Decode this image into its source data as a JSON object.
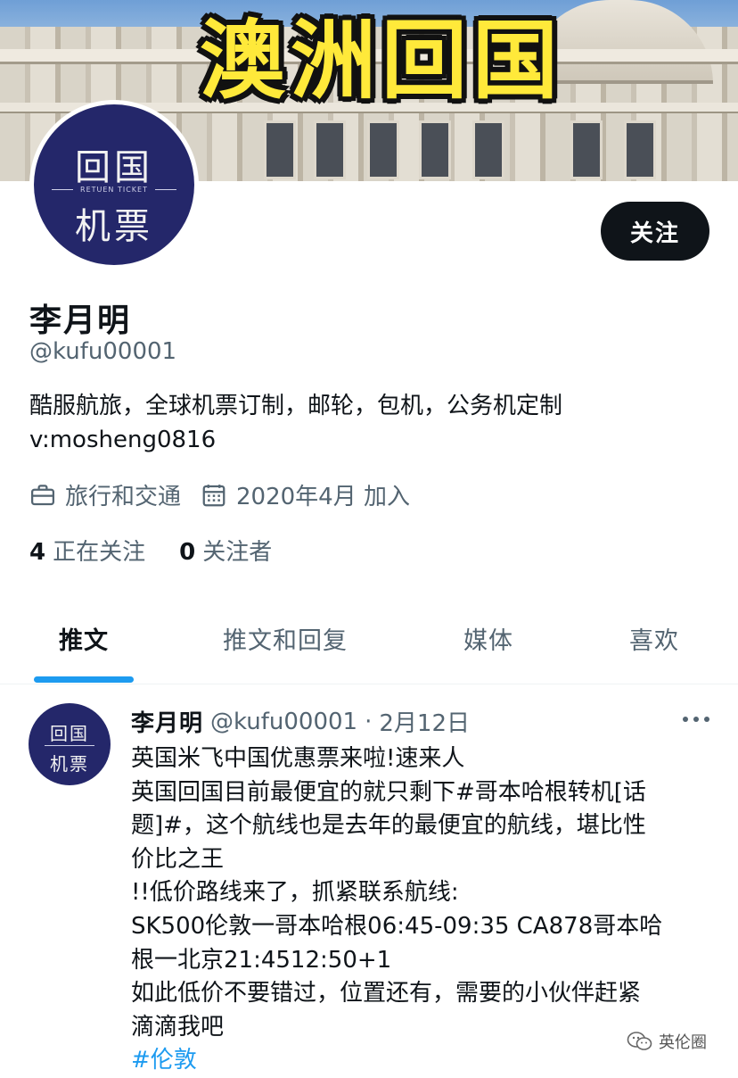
{
  "banner": {
    "title": "澳洲回国"
  },
  "avatar": {
    "line1": "回国",
    "line2": "机票",
    "tagline": "RETUEN TICKET"
  },
  "profile": {
    "follow_label": "关注",
    "name": "李月明",
    "handle": "@kufu00001",
    "bio_line1": "酷服航旅，全球机票订制，邮轮，包机，公务机定制",
    "bio_line2": "v:mosheng0816",
    "category": "旅行和交通",
    "joined": "2020年4月 加入",
    "following_count": "4",
    "following_label": "正在关注",
    "followers_count": "0",
    "followers_label": "关注者"
  },
  "tabs": [
    {
      "label": "推文",
      "active": true
    },
    {
      "label": "推文和回复",
      "active": false
    },
    {
      "label": "媒体",
      "active": false
    },
    {
      "label": "喜欢",
      "active": false
    }
  ],
  "tweet": {
    "author": "李月明",
    "handle": "@kufu00001",
    "separator": "·",
    "date": "2月12日",
    "lines": [
      "英国米飞中国优惠票来啦!速来人",
      "英国回国目前最便宜的就只剩下#哥本哈根转机[话",
      "题]#，这个航线也是去年的最便宜的航线，堪比性",
      "价比之王",
      "!!低价路线来了，抓紧联系航线:",
      "SK500伦敦一哥本哈根06:45-09:35 CA878哥本哈",
      "根一北京21:4512:50+1",
      "如此低价不要错过，位置还有，需要的小伙伴赶紧",
      "滴滴我吧"
    ],
    "hashtag": "#伦敦"
  },
  "watermark": {
    "text": "英伦圈"
  },
  "colors": {
    "accent": "#1d9bf0",
    "text": "#0f1419",
    "muted": "#536471",
    "avatar_bg": "#24276a",
    "banner_title": "#ffe93a"
  },
  "icons": {
    "category": "briefcase-icon",
    "joined": "calendar-icon",
    "more": "more-horizontal-icon",
    "watermark": "wechat-icon"
  }
}
